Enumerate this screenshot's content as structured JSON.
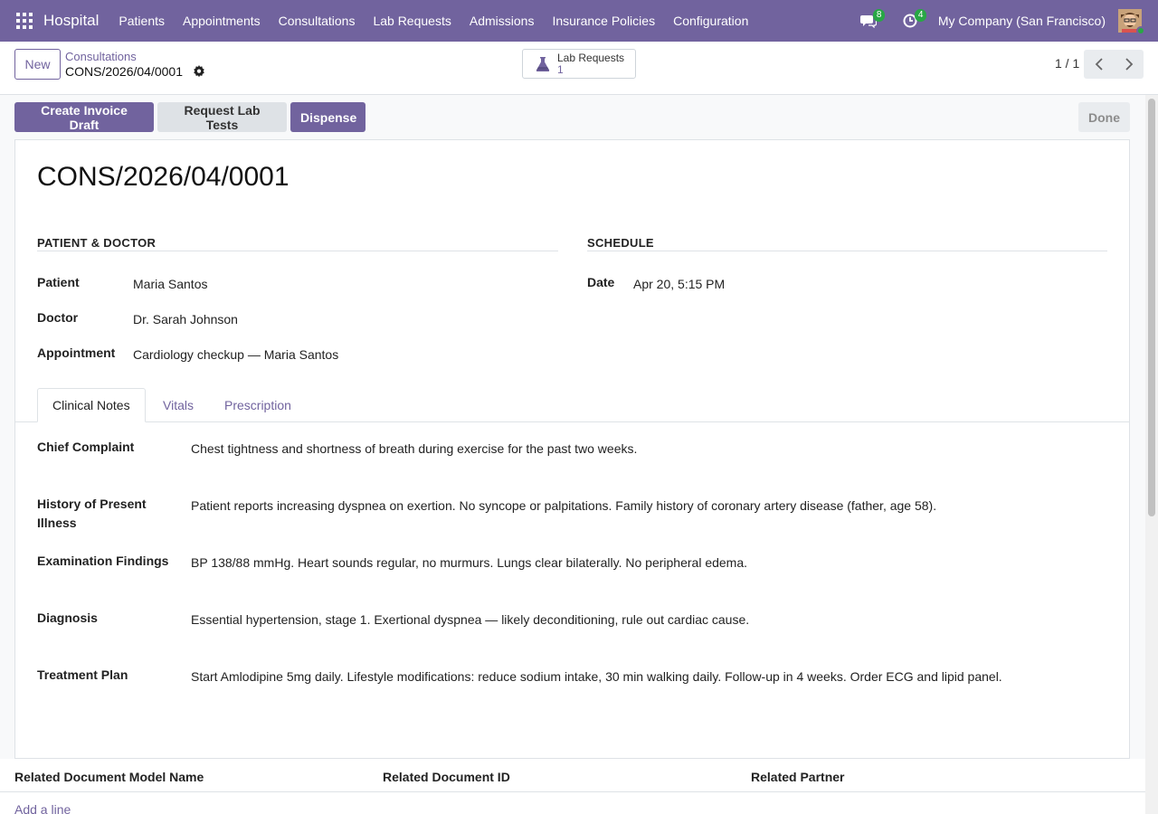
{
  "navbar": {
    "brand": "Hospital",
    "menu": [
      "Patients",
      "Appointments",
      "Consultations",
      "Lab Requests",
      "Admissions",
      "Insurance Policies",
      "Configuration"
    ],
    "messages_count": "8",
    "activities_count": "4",
    "company": "My Company (San Francisco)"
  },
  "control": {
    "new_label": "New",
    "breadcrumb_parent": "Consultations",
    "breadcrumb_current": "CONS/2026/04/0001",
    "smart_button": {
      "label": "Lab Requests",
      "value": "1"
    },
    "pager": "1 / 1"
  },
  "actions": {
    "create_invoice": "Create Invoice Draft",
    "request_lab": "Request Lab Tests",
    "dispense": "Dispense",
    "done": "Done"
  },
  "record": {
    "title": "CONS/2026/04/0001",
    "patient_doctor_group": "PATIENT & DOCTOR",
    "schedule_group": "SCHEDULE",
    "fields": {
      "patient_label": "Patient",
      "patient_value": "Maria Santos",
      "doctor_label": "Doctor",
      "doctor_value": "Dr. Sarah Johnson",
      "appointment_label": "Appointment",
      "appointment_value": "Cardiology checkup — Maria Santos",
      "date_label": "Date",
      "date_value": "Apr 20, 5:15 PM"
    },
    "tabs": [
      "Clinical Notes",
      "Vitals",
      "Prescription"
    ],
    "notes": [
      {
        "label": "Chief Complaint",
        "value": "Chest tightness and shortness of breath during exercise for the past two weeks."
      },
      {
        "label": "History of Present Illness",
        "value": "Patient reports increasing dyspnea on exertion. No syncope or palpitations. Family history of coronary artery disease (father, age 58)."
      },
      {
        "label": "Examination Findings",
        "value": "BP 138/88 mmHg. Heart sounds regular, no murmurs. Lungs clear bilaterally. No peripheral edema."
      },
      {
        "label": "Diagnosis",
        "value": "Essential hypertension, stage 1. Exertional dyspnea — likely deconditioning, rule out cardiac cause."
      },
      {
        "label": "Treatment Plan",
        "value": "Start Amlodipine 5mg daily. Lifestyle modifications: reduce sodium intake, 30 min walking daily. Follow-up in 4 weeks. Order ECG and lipid panel."
      }
    ]
  },
  "related": {
    "col_model": "Related Document Model Name",
    "col_id": "Related Document ID",
    "col_partner": "Related Partner",
    "add_line": "Add a line"
  },
  "colors": {
    "primary": "#71639e",
    "badge": "#28a745"
  }
}
